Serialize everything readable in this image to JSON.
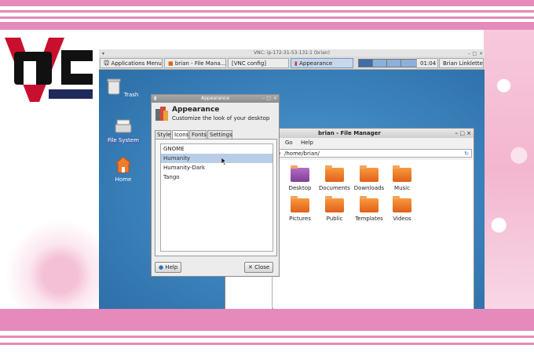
{
  "vnc_window": {
    "title": "VNC: ip-172-31-53-131:1 (brian)"
  },
  "panel": {
    "tasks": [
      {
        "label": "Applications Menu",
        "icon": "mouse-icon"
      },
      {
        "label": "brian - File Mana...",
        "icon": "folder-icon"
      },
      {
        "label": "[VNC config]",
        "icon": ""
      },
      {
        "label": "Appearance",
        "icon": "appearance-icon"
      }
    ],
    "clock": "01:04",
    "user": "Brian Linkletter"
  },
  "desktop_icons": [
    {
      "label": "Trash",
      "icon": "trash-icon"
    },
    {
      "label": "File System",
      "icon": "drive-icon"
    },
    {
      "label": "Home",
      "icon": "home-icon"
    }
  ],
  "file_manager": {
    "title": "brian - File Manager",
    "menu": [
      "Go",
      "Help"
    ],
    "location": "/home/brian/",
    "sidebar_fragments": [
      "n",
      "etwork"
    ],
    "items": [
      {
        "label": "Desktop",
        "color": "purple"
      },
      {
        "label": "Documents",
        "color": "orange"
      },
      {
        "label": "Downloads",
        "color": "orange"
      },
      {
        "label": "Music",
        "color": "orange"
      },
      {
        "label": "Pictures",
        "color": "orange"
      },
      {
        "label": "Public",
        "color": "orange"
      },
      {
        "label": "Templates",
        "color": "orange"
      },
      {
        "label": "Videos",
        "color": "orange"
      }
    ]
  },
  "appearance": {
    "window_title": "Appearance",
    "heading": "Appearance",
    "subheading": "Customize the look of your desktop",
    "tabs": [
      "Style",
      "Icons",
      "Fonts",
      "Settings"
    ],
    "active_tab": "Icons",
    "themes": [
      "GNOME",
      "Humanity",
      "Humanity-Dark",
      "Tango"
    ],
    "selected_theme": "Humanity",
    "help_label": "Help",
    "close_label": "Close"
  },
  "colors": {
    "frame_pink": "#e58abb",
    "desktop_blue": "#3b7bb0",
    "logo_red": "#c8102e",
    "logo_navy": "#1f2a5a",
    "selection": "#b8cde6"
  }
}
